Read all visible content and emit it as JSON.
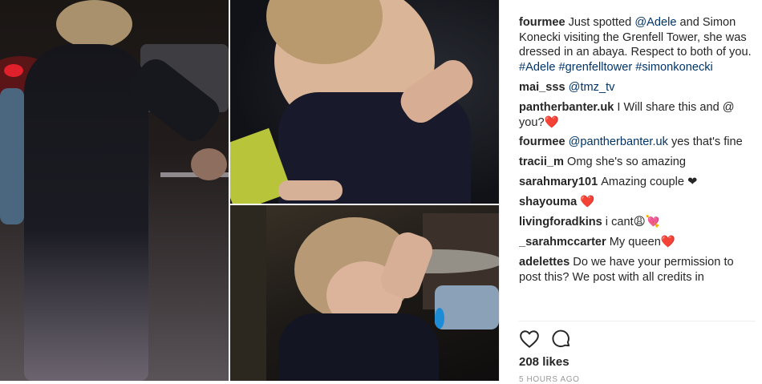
{
  "post": {
    "comments": [
      {
        "user": "fourmee",
        "parts": [
          {
            "t": "Just spotted "
          },
          {
            "t": "@Adele",
            "link": true
          },
          {
            "t": " and Simon Konecki visiting the Grenfell Tower, she was dressed in an abaya. Respect to both of you. "
          },
          {
            "t": "#Adele",
            "link": true
          },
          {
            "t": " "
          },
          {
            "t": "#grenfelltower",
            "link": true
          },
          {
            "t": " "
          },
          {
            "t": "#simonkonecki",
            "link": true
          }
        ]
      },
      {
        "user": "mai_sss",
        "parts": [
          {
            "t": "@tmz_tv",
            "link": true
          }
        ]
      },
      {
        "user": "pantherbanter.uk",
        "parts": [
          {
            "t": "I Will share this and @ you?"
          },
          {
            "t": "❤️",
            "heart": true
          }
        ]
      },
      {
        "user": "fourmee",
        "parts": [
          {
            "t": "@pantherbanter.uk",
            "link": true
          },
          {
            "t": " yes that's fine"
          }
        ]
      },
      {
        "user": "tracii_m",
        "parts": [
          {
            "t": "Omg she's so amazing"
          }
        ]
      },
      {
        "user": "sarahmary101",
        "parts": [
          {
            "t": "Amazing couple ❤"
          }
        ]
      },
      {
        "user": "shayouma",
        "parts": [
          {
            "t": "❤️",
            "heart": true
          }
        ]
      },
      {
        "user": "livingforadkins",
        "parts": [
          {
            "t": "i cant😩💘"
          }
        ]
      },
      {
        "user": "_sarahmccarter",
        "parts": [
          {
            "t": "My queen"
          },
          {
            "t": "❤️",
            "heart": true
          }
        ]
      },
      {
        "user": "adelettes",
        "parts": [
          {
            "t": "Do we have your permission to post this? We post with all credits in"
          }
        ]
      }
    ],
    "likes_label": "208 likes",
    "time_label": "5 HOURS AGO",
    "icons": {
      "like": "heart-icon",
      "comment": "comment-icon"
    }
  }
}
